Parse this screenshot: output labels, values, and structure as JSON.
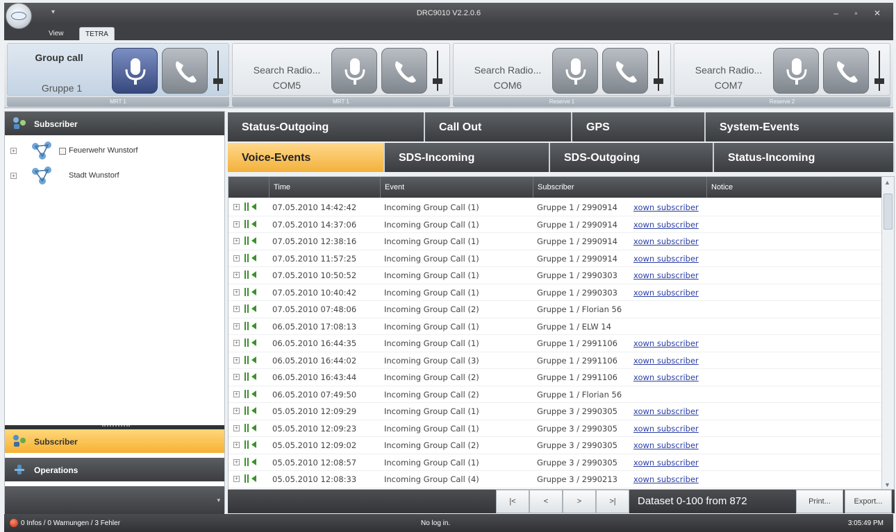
{
  "window": {
    "title": "DRC9010 V2.2.0.6",
    "controls": [
      "–",
      "▫",
      "✕"
    ]
  },
  "ribbon_tabs": [
    "View",
    "TETRA"
  ],
  "ribbon": {
    "groups": [
      {
        "line1": "Group call",
        "line2": "Gruppe 1",
        "caption": "MRT 1"
      },
      {
        "line1": "Search Radio...",
        "line2": "COM5",
        "caption": "MRT 1"
      },
      {
        "line1": "Search Radio...",
        "line2": "COM6",
        "caption": "Reserve 1"
      },
      {
        "line1": "Search Radio...",
        "line2": "COM7",
        "caption": "Reserve 2"
      }
    ]
  },
  "left_panel": {
    "header": "Subscriber",
    "tree": [
      {
        "label": "Feuerwehr Wunstorf"
      },
      {
        "label": "Stadt Wunstorf"
      }
    ],
    "nav": {
      "subscriber": "Subscriber",
      "operations": "Operations"
    }
  },
  "tabs": {
    "row1": [
      "Status-Outgoing",
      "Call Out",
      "GPS",
      "System-Events"
    ],
    "row2": [
      "Voice-Events",
      "SDS-Incoming",
      "SDS-Outgoing",
      "Status-Incoming"
    ],
    "active": "Voice-Events"
  },
  "table": {
    "headers": [
      "Time",
      "Event",
      "Subscriber",
      "Notice"
    ],
    "rows": [
      {
        "time": "07.05.2010 14:42:42",
        "event": "Incoming Group Call (1)",
        "subscriber": "Gruppe 1 / 2990914",
        "link": "xown subscriber"
      },
      {
        "time": "07.05.2010 14:37:06",
        "event": "Incoming Group Call (1)",
        "subscriber": "Gruppe 1 / 2990914",
        "link": "xown subscriber"
      },
      {
        "time": "07.05.2010 12:38:16",
        "event": "Incoming Group Call (1)",
        "subscriber": "Gruppe 1 / 2990914",
        "link": "xown subscriber"
      },
      {
        "time": "07.05.2010 11:57:25",
        "event": "Incoming Group Call (1)",
        "subscriber": "Gruppe 1 / 2990914",
        "link": "xown subscriber"
      },
      {
        "time": "07.05.2010 10:50:52",
        "event": "Incoming Group Call (1)",
        "subscriber": "Gruppe 1 / 2990303",
        "link": "xown subscriber"
      },
      {
        "time": "07.05.2010 10:40:42",
        "event": "Incoming Group Call (1)",
        "subscriber": "Gruppe 1 / 2990303",
        "link": "xown subscriber"
      },
      {
        "time": "07.05.2010 07:48:06",
        "event": "Incoming Group Call (2)",
        "subscriber": "Gruppe 1 / Florian 56",
        "link": ""
      },
      {
        "time": "06.05.2010 17:08:13",
        "event": "Incoming Group Call (1)",
        "subscriber": "Gruppe 1 / ELW 14",
        "link": ""
      },
      {
        "time": "06.05.2010 16:44:35",
        "event": "Incoming Group Call (1)",
        "subscriber": "Gruppe 1 / 2991106",
        "link": "xown subscriber"
      },
      {
        "time": "06.05.2010 16:44:02",
        "event": "Incoming Group Call (3)",
        "subscriber": "Gruppe 1 / 2991106",
        "link": "xown subscriber"
      },
      {
        "time": "06.05.2010 16:43:44",
        "event": "Incoming Group Call (2)",
        "subscriber": "Gruppe 1 / 2991106",
        "link": "xown subscriber"
      },
      {
        "time": "06.05.2010 07:49:50",
        "event": "Incoming Group Call (2)",
        "subscriber": "Gruppe 1 / Florian 56",
        "link": ""
      },
      {
        "time": "05.05.2010 12:09:29",
        "event": "Incoming Group Call (1)",
        "subscriber": "Gruppe 3 / 2990305",
        "link": "xown subscriber"
      },
      {
        "time": "05.05.2010 12:09:23",
        "event": "Incoming Group Call (1)",
        "subscriber": "Gruppe 3 / 2990305",
        "link": "xown subscriber"
      },
      {
        "time": "05.05.2010 12:09:02",
        "event": "Incoming Group Call (2)",
        "subscriber": "Gruppe 3 / 2990305",
        "link": "xown subscriber"
      },
      {
        "time": "05.05.2010 12:08:57",
        "event": "Incoming Group Call (1)",
        "subscriber": "Gruppe 3 / 2990305",
        "link": "xown subscriber"
      },
      {
        "time": "05.05.2010 12:08:33",
        "event": "Incoming Group Call (4)",
        "subscriber": "Gruppe 3 / 2990213",
        "link": "xown subscriber"
      }
    ]
  },
  "pager": {
    "first": "|<",
    "prev": "<",
    "next": ">",
    "last": ">|",
    "dataset": "Dataset 0-100 from 872",
    "print": "Print...",
    "export": "Export..."
  },
  "status": {
    "left": "0 Infos / 0 Warnungen / 3 Fehler",
    "middle": "No log in.",
    "right": "3:05:49 PM"
  },
  "colors": {
    "active_tab": "#f3b13c",
    "dark_header": "#3b3d40",
    "link": "#2b3fa6"
  }
}
